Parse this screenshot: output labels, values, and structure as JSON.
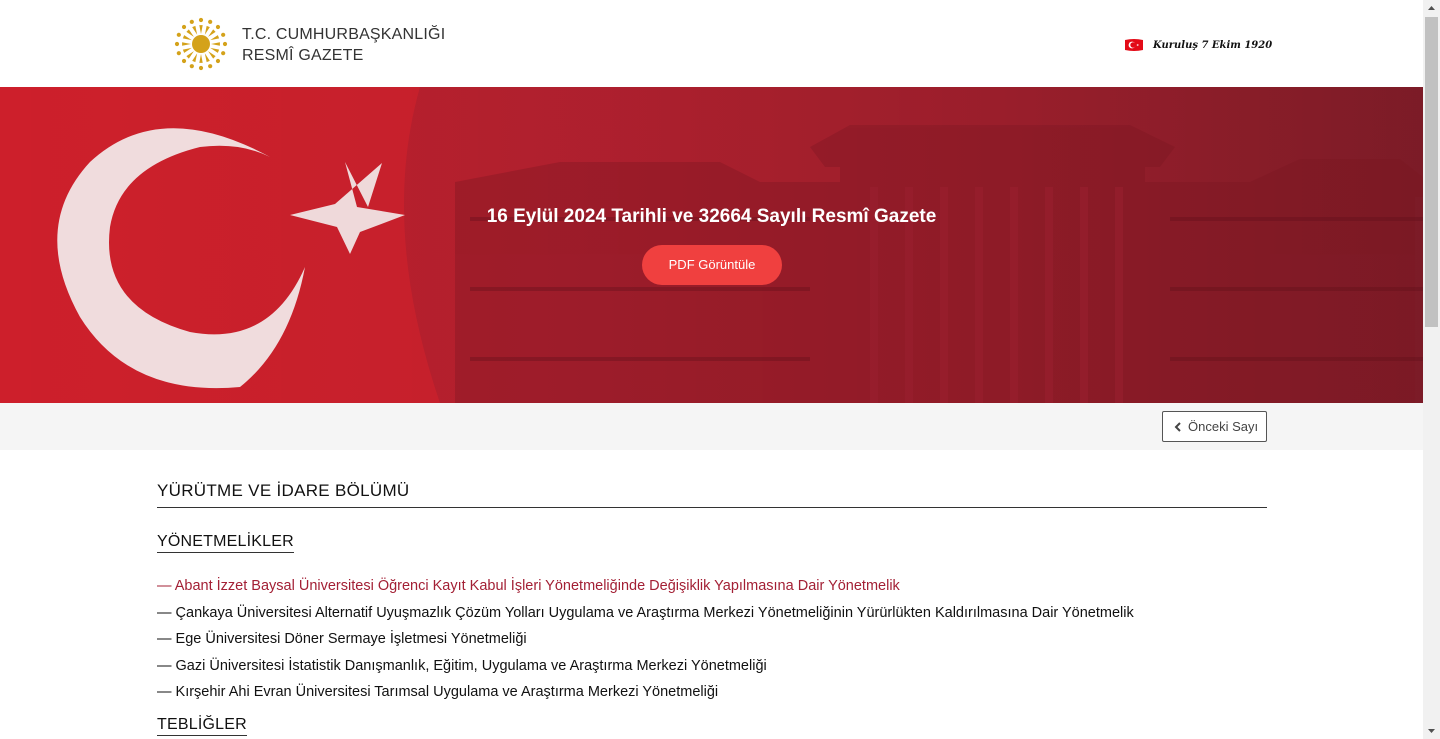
{
  "header": {
    "logo_line1": "T.C. CUMHURBAŞKANLIĞI",
    "logo_line2": "RESMÎ GAZETE",
    "founded": "Kuruluş 7 Ekim 1920"
  },
  "hero": {
    "title": "16 Eylül 2024 Tarihli ve 32664 Sayılı Resmî Gazete",
    "pdf_button": "PDF Görüntüle"
  },
  "nav": {
    "previous_issue": "Önceki Sayı"
  },
  "content": {
    "section_title": "YÜRÜTME VE İDARE BÖLÜMÜ",
    "subsections": [
      {
        "title": "YÖNETMELİKLER",
        "items": [
          "— Abant İzzet Baysal Üniversitesi Öğrenci Kayıt Kabul İşleri Yönetmeliğinde Değişiklik Yapılmasına Dair Yönetmelik",
          "— Çankaya Üniversitesi Alternatif Uyuşmazlık Çözüm Yolları Uygulama ve Araştırma Merkezi Yönetmeliğinin Yürürlükten Kaldırılmasına Dair Yönetmelik",
          "— Ege Üniversitesi Döner Sermaye İşletmesi Yönetmeliği",
          "— Gazi Üniversitesi İstatistik Danışmanlık, Eğitim, Uygulama ve Araştırma Merkezi Yönetmeliği",
          "— Kırşehir Ahi Evran Üniversitesi Tarımsal Uygulama ve Araştırma Merkezi Yönetmeliği"
        ]
      },
      {
        "title": "TEBLİĞLER"
      }
    ]
  },
  "colors": {
    "brand_red": "#c41e2a",
    "button_red": "#f0403f",
    "active_link": "#a32035",
    "emblem_gold": "#d4a21a"
  },
  "icons": {
    "emblem": "presidential-sun-emblem",
    "flag": "turkish-flag-icon",
    "previous": "chevron-left-icon"
  }
}
